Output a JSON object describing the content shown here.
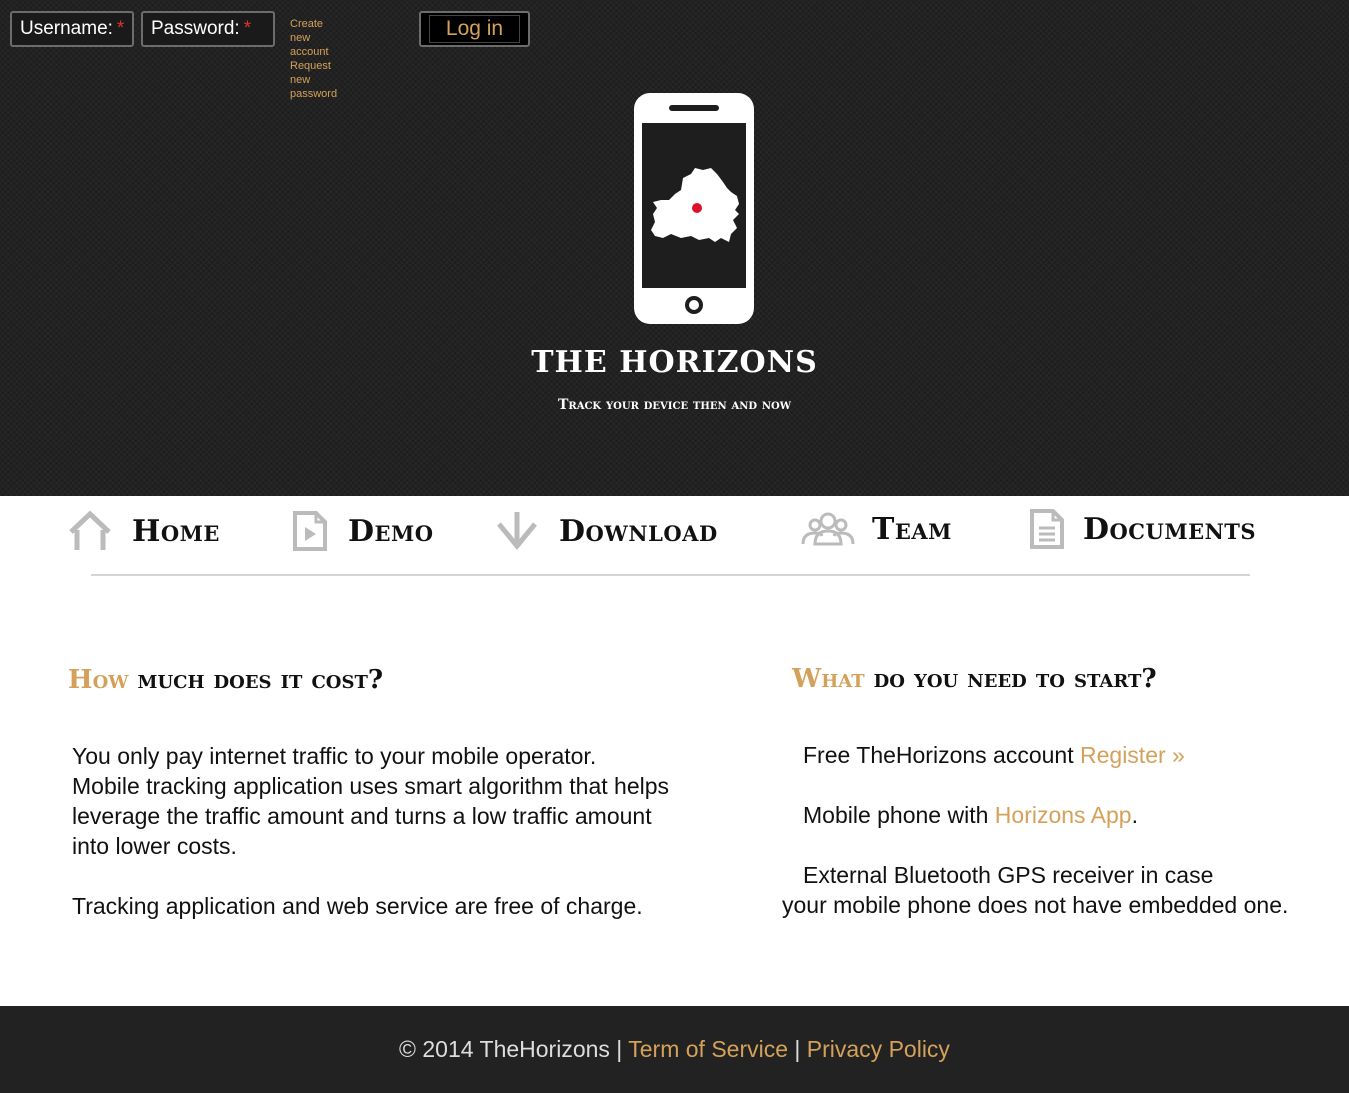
{
  "login": {
    "username_label": "Username:",
    "password_label": "Password:",
    "required_mark": "*",
    "create_account": "Create new account",
    "request_password": "Request new password",
    "login_button": "Log in"
  },
  "hero": {
    "title": "THE HORIZONS",
    "tagline": "Track your device then and now"
  },
  "nav": {
    "items": [
      {
        "label": "Home",
        "icon": "home-icon"
      },
      {
        "label": "Demo",
        "icon": "video-file-icon"
      },
      {
        "label": "Download",
        "icon": "download-arrow-icon"
      },
      {
        "label": "Team",
        "icon": "group-icon"
      },
      {
        "label": "Documents",
        "icon": "document-icon"
      }
    ]
  },
  "cost": {
    "heading_accent": "How",
    "heading_rest": "much does it cost?",
    "line1": "You only pay internet traffic to your mobile operator.",
    "line2": "Mobile tracking application uses smart algorithm that helps",
    "line3": "leverage the traffic amount and turns a low traffic amount",
    "line4": "into lower costs.",
    "line5": "Tracking application and web service are free of charge."
  },
  "start": {
    "heading_accent": "What",
    "heading_rest": "do you need to start?",
    "item1_text": "Free TheHorizons account ",
    "item1_link": "Register »",
    "item2_text": "Mobile phone with ",
    "item2_link": "Horizons App",
    "item2_end": ".",
    "item3_line1": "External Bluetooth GPS receiver in case",
    "item3_line2": "your mobile phone does not have embedded one."
  },
  "footer": {
    "copyright": "© 2014 TheHorizons | ",
    "terms": "Term of Service",
    "separator": " | ",
    "privacy": "Privacy Policy"
  },
  "colors": {
    "accent": "#d4a15a",
    "dark": "#222222",
    "required": "#dd3333",
    "location_dot": "#e0102a"
  }
}
